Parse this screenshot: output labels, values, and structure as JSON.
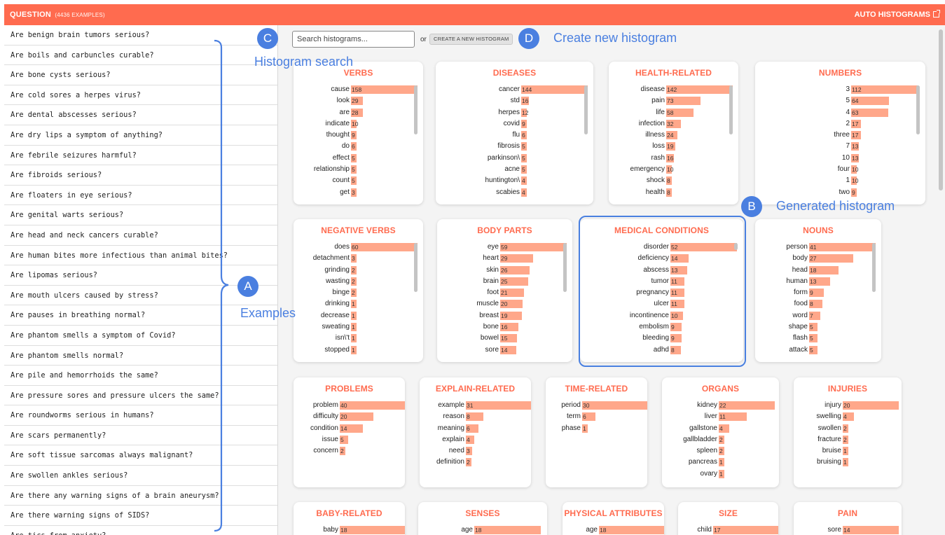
{
  "header": {
    "title": "QUESTION",
    "count_label": "(4436 EXAMPLES)",
    "auto_label": "AUTO HISTOGRAMS"
  },
  "examples": [
    "Are benign brain tumors serious?",
    "Are boils and carbuncles curable?",
    "Are bone cysts serious?",
    "Are cold sores a herpes virus?",
    "Are dental abscesses serious?",
    "Are dry lips a symptom of anything?",
    "Are febrile seizures harmful?",
    "Are fibroids serious?",
    "Are floaters in eye serious?",
    "Are genital warts serious?",
    "Are head and neck cancers curable?",
    "Are human bites more infectious than animal bites?",
    "Are lipomas serious?",
    "Are mouth ulcers caused by stress?",
    "Are pauses in breathing normal?",
    "Are phantom smells a symptom of Covid?",
    "Are phantom smells normal?",
    "Are pile and hemorrhoids the same?",
    "Are pressure sores and pressure ulcers the same?",
    "Are roundworms serious in humans?",
    "Are scars permanently?",
    "Are soft tissue sarcomas always malignant?",
    "Are swollen ankles serious?",
    "Are there any warning signs of a brain aneurysm?",
    "Are there warning signs of SIDS?",
    "Are tics from anxiety?"
  ],
  "search": {
    "placeholder": "Search histograms...",
    "or_text": "or",
    "create_label": "CREATE A NEW HISTOGRAM"
  },
  "histograms": [
    {
      "title": "VERBS",
      "max": 158,
      "items": [
        [
          "cause",
          158
        ],
        [
          "look",
          29
        ],
        [
          "are",
          28
        ],
        [
          "indicate",
          10
        ],
        [
          "thought",
          9
        ],
        [
          "do",
          6
        ],
        [
          "effect",
          5
        ],
        [
          "relationship",
          5
        ],
        [
          "count",
          5
        ],
        [
          "get",
          3
        ]
      ]
    },
    {
      "title": "DISEASES",
      "max": 144,
      "items": [
        [
          "cancer",
          144
        ],
        [
          "std",
          16
        ],
        [
          "herpes",
          12
        ],
        [
          "covid",
          9
        ],
        [
          "flu",
          6
        ],
        [
          "fibrosis",
          5
        ],
        [
          "parkinson\\",
          5
        ],
        [
          "acne",
          5
        ],
        [
          "huntington\\",
          4
        ],
        [
          "scabies",
          4
        ]
      ]
    },
    {
      "title": "HEALTH-RELATED",
      "max": 142,
      "items": [
        [
          "disease",
          142
        ],
        [
          "pain",
          73
        ],
        [
          "life",
          58
        ],
        [
          "infection",
          32
        ],
        [
          "illness",
          24
        ],
        [
          "loss",
          19
        ],
        [
          "rash",
          16
        ],
        [
          "emergency",
          10
        ],
        [
          "shock",
          8
        ],
        [
          "health",
          8
        ]
      ]
    },
    {
      "title": "NUMBERS",
      "max": 112,
      "items": [
        [
          "3",
          112
        ],
        [
          "5",
          64
        ],
        [
          "4",
          63
        ],
        [
          "2",
          17
        ],
        [
          "three",
          17
        ],
        [
          "7",
          13
        ],
        [
          "10",
          13
        ],
        [
          "four",
          10
        ],
        [
          "1",
          10
        ],
        [
          "two",
          9
        ]
      ]
    },
    {
      "title": "NEGATIVE VERBS",
      "max": 60,
      "items": [
        [
          "does",
          60
        ],
        [
          "detachment",
          3
        ],
        [
          "grinding",
          2
        ],
        [
          "wasting",
          2
        ],
        [
          "binge",
          2
        ],
        [
          "drinking",
          1
        ],
        [
          "decrease",
          1
        ],
        [
          "sweating",
          1
        ],
        [
          "isn\\'t",
          1
        ],
        [
          "stopped",
          1
        ]
      ]
    },
    {
      "title": "BODY PARTS",
      "max": 59,
      "items": [
        [
          "eye",
          59
        ],
        [
          "heart",
          29
        ],
        [
          "skin",
          26
        ],
        [
          "brain",
          25
        ],
        [
          "foot",
          21
        ],
        [
          "muscle",
          20
        ],
        [
          "breast",
          19
        ],
        [
          "bone",
          16
        ],
        [
          "bowel",
          15
        ],
        [
          "sore",
          14
        ]
      ]
    },
    {
      "title": "MEDICAL CONDITIONS",
      "max": 52,
      "items": [
        [
          "disorder",
          52
        ],
        [
          "deficiency",
          14
        ],
        [
          "abscess",
          13
        ],
        [
          "tumor",
          11
        ],
        [
          "pregnancy",
          11
        ],
        [
          "ulcer",
          11
        ],
        [
          "incontinence",
          10
        ],
        [
          "embolism",
          9
        ],
        [
          "bleeding",
          9
        ],
        [
          "adhd",
          8
        ]
      ]
    },
    {
      "title": "NOUNS",
      "max": 41,
      "items": [
        [
          "person",
          41
        ],
        [
          "body",
          27
        ],
        [
          "head",
          18
        ],
        [
          "human",
          13
        ],
        [
          "form",
          9
        ],
        [
          "food",
          8
        ],
        [
          "word",
          7
        ],
        [
          "shape",
          5
        ],
        [
          "flash",
          5
        ],
        [
          "attack",
          5
        ]
      ]
    },
    {
      "title": "PROBLEMS",
      "max": 40,
      "items": [
        [
          "problem",
          40
        ],
        [
          "difficulty",
          20
        ],
        [
          "condition",
          14
        ],
        [
          "issue",
          5
        ],
        [
          "concern",
          2
        ]
      ]
    },
    {
      "title": "EXPLAIN-RELATED",
      "max": 31,
      "items": [
        [
          "example",
          31
        ],
        [
          "reason",
          8
        ],
        [
          "meaning",
          6
        ],
        [
          "explain",
          4
        ],
        [
          "need",
          3
        ],
        [
          "definition",
          2
        ]
      ]
    },
    {
      "title": "TIME-RELATED",
      "max": 30,
      "items": [
        [
          "period",
          30
        ],
        [
          "term",
          6
        ],
        [
          "phase",
          1
        ]
      ]
    },
    {
      "title": "ORGANS",
      "max": 22,
      "items": [
        [
          "kidney",
          22
        ],
        [
          "liver",
          11
        ],
        [
          "gallstone",
          4
        ],
        [
          "gallbladder",
          2
        ],
        [
          "spleen",
          2
        ],
        [
          "pancreas",
          1
        ],
        [
          "ovary",
          1
        ]
      ]
    },
    {
      "title": "INJURIES",
      "max": 20,
      "items": [
        [
          "injury",
          20
        ],
        [
          "swelling",
          4
        ],
        [
          "swollen",
          2
        ],
        [
          "fracture",
          2
        ],
        [
          "bruise",
          1
        ],
        [
          "bruising",
          1
        ]
      ]
    },
    {
      "title": "BABY-RELATED",
      "max": 18,
      "items": [
        [
          "baby",
          18
        ]
      ]
    },
    {
      "title": "SENSES",
      "max": 18,
      "items": [
        [
          "age",
          18
        ]
      ]
    },
    {
      "title": "PHYSICAL ATTRIBUTES",
      "max": 18,
      "items": [
        [
          "age",
          18
        ]
      ]
    },
    {
      "title": "SIZE",
      "max": 17,
      "items": [
        [
          "child",
          17
        ]
      ]
    },
    {
      "title": "PAIN",
      "max": 14,
      "items": [
        [
          "sore",
          14
        ]
      ]
    }
  ],
  "annotations": {
    "a": {
      "letter": "A",
      "text": "Examples"
    },
    "b": {
      "letter": "B",
      "text": "Generated histogram"
    },
    "c": {
      "letter": "C",
      "text": "Histogram search"
    },
    "d": {
      "letter": "D",
      "text": "Create new histogram"
    }
  },
  "colors": {
    "header": "#ff6b4f",
    "bar": "#ffa78a",
    "title": "#ff6b4f",
    "annotation": "#4a7fe0"
  }
}
